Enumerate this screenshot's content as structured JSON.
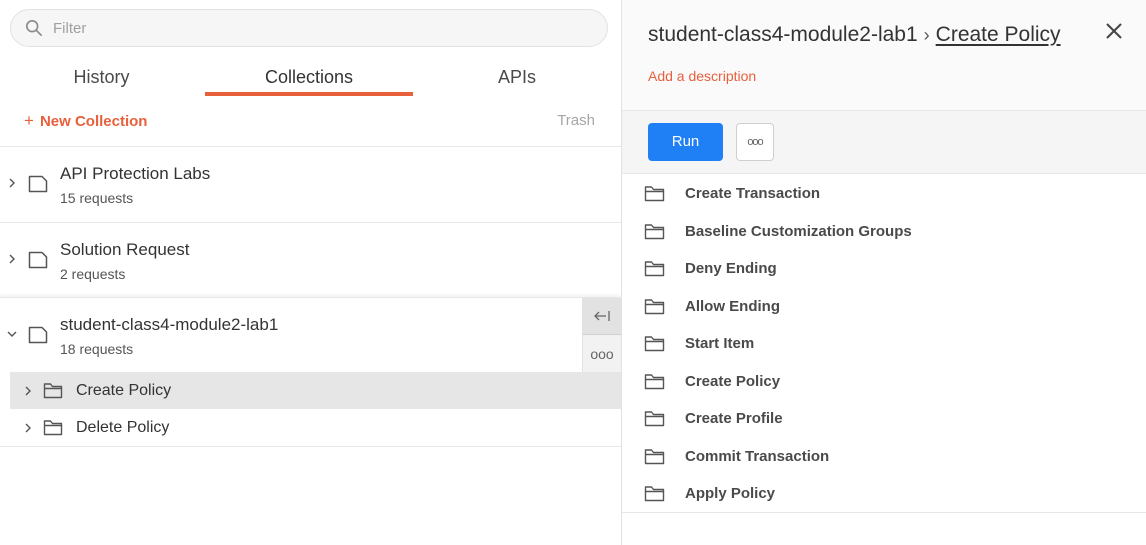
{
  "search": {
    "placeholder": "Filter",
    "value": ""
  },
  "tabs": [
    {
      "label": "History",
      "active": false
    },
    {
      "label": "Collections",
      "active": true
    },
    {
      "label": "APIs",
      "active": false
    }
  ],
  "actions": {
    "new_collection_label": "New Collection",
    "trash_label": "Trash"
  },
  "collections": [
    {
      "name": "API Protection Labs",
      "count": "15 requests",
      "expanded": false
    },
    {
      "name": "Solution Request",
      "count": "2 requests",
      "expanded": false
    },
    {
      "name": "student-class4-module2-lab1",
      "count": "18 requests",
      "expanded": true,
      "folders": [
        {
          "label": "Create Policy",
          "selected": true
        },
        {
          "label": "Delete Policy",
          "selected": false
        }
      ]
    }
  ],
  "detail": {
    "collection": "student-class4-module2-lab1",
    "separator": "›",
    "current": "Create Policy",
    "description_link": "Add a description",
    "run_label": "Run",
    "folders": [
      "Create Transaction",
      "Baseline Customization Groups",
      "Deny Ending",
      "Allow Ending",
      "Start Item",
      "Create Policy",
      "Create Profile",
      "Commit Transaction",
      "Apply Policy"
    ]
  },
  "colors": {
    "accent": "#e8603c",
    "primary": "#1f7ff5",
    "selected_bg": "#e6e6e6"
  },
  "icons": {
    "search": "search-icon",
    "folder": "folder-icon",
    "chevron_right": "chevron-right-icon",
    "chevron_down": "chevron-down-icon",
    "collapse": "collapse-left-icon",
    "more": "more-options-icon",
    "close": "close-icon"
  }
}
